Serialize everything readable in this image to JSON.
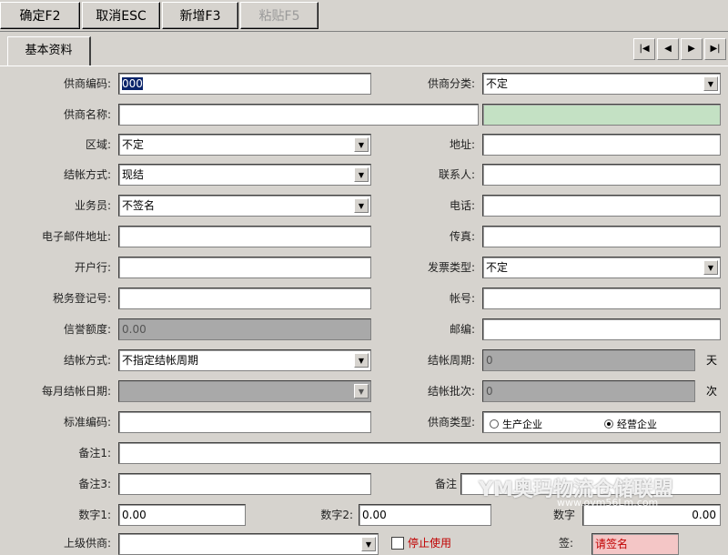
{
  "toolbar": {
    "ok_label": "确定F2",
    "cancel_label": "取消ESC",
    "new_label": "新增F3",
    "paste_label": "粘贴F5"
  },
  "tabs": {
    "basic_label": "基本资料"
  },
  "nav": {
    "first": "|◀",
    "prev": "◀",
    "next": "▶",
    "last": "▶|"
  },
  "form": {
    "supplier_code": {
      "label": "供商编码:",
      "value": "000"
    },
    "supplier_category": {
      "label": "供商分类:",
      "value": "不定"
    },
    "supplier_name": {
      "label": "供商名称:",
      "value": ""
    },
    "region": {
      "label": "区域:",
      "value": "不定"
    },
    "address": {
      "label": "地址:",
      "value": ""
    },
    "purchase_method": {
      "label": "结帐方式:",
      "value": "现结"
    },
    "contact": {
      "label": "联系人:",
      "value": ""
    },
    "salesperson": {
      "label": "业务员:",
      "value": "不签名"
    },
    "phone": {
      "label": "电话:",
      "value": ""
    },
    "email": {
      "label": "电子邮件地址:",
      "value": ""
    },
    "fax": {
      "label": "传真:",
      "value": ""
    },
    "bank": {
      "label": "开户行:",
      "value": ""
    },
    "invoice_type": {
      "label": "发票类型:",
      "value": "不定"
    },
    "tax_reg_no": {
      "label": "税务登记号:",
      "value": ""
    },
    "account_no": {
      "label": "帐号:",
      "value": ""
    },
    "credit_limit": {
      "label": "信誉额度:",
      "value": "0.00"
    },
    "postcode": {
      "label": "邮编:",
      "value": ""
    },
    "settle_method": {
      "label": "结帐方式:",
      "value": "不指定结帐周期"
    },
    "settle_period": {
      "label": "结帐周期:",
      "value": "0",
      "unit": "天"
    },
    "monthly_settle_day": {
      "label": "每月结帐日期:",
      "value": ""
    },
    "settle_count": {
      "label": "结帐批次:",
      "value": "0",
      "unit": "次"
    },
    "standard_code": {
      "label": "标准编码:",
      "value": ""
    },
    "supplier_type": {
      "label": "供商类型:",
      "options": [
        "生产企业",
        "经营企业"
      ],
      "selected": 1
    },
    "remark1": {
      "label": "备注1:",
      "value": ""
    },
    "remark3": {
      "label": "备注3:",
      "value": ""
    },
    "remark_partial": {
      "label": "备注"
    },
    "number1": {
      "label": "数字1:",
      "value": "0.00"
    },
    "number2": {
      "label": "数字2:",
      "value": "0.00"
    },
    "number3": {
      "label": "数字",
      "value": "0.00"
    },
    "upper_supplier": {
      "label": "上级供商:",
      "value": ""
    },
    "stop_label": "停止使用",
    "last_label": "签:",
    "last_value": "请签名"
  },
  "watermark": {
    "text": "YM奥玛物流仓储联盟",
    "url": "www.oym56Lm.com"
  }
}
